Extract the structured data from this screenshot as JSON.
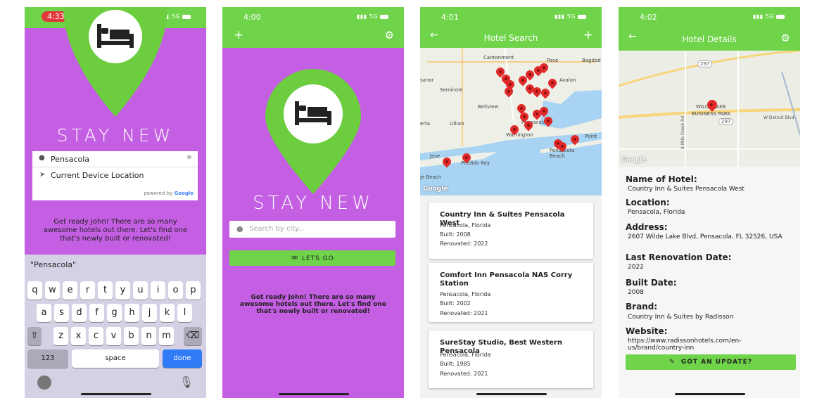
{
  "screen1": {
    "time": "4:33",
    "signal": "5G",
    "app_title": "STAY NEW",
    "search_value": "Pensacola",
    "suggestion": "Current Device Location",
    "powered_by": "powered by",
    "powered_brand": "Google",
    "welcome": "Get ready John! There are so many awesome hotels out there. Let's find one that's newly built or renovated!",
    "autocorrect": "\"Pensacola\"",
    "keys_row1": [
      "q",
      "w",
      "e",
      "r",
      "t",
      "y",
      "u",
      "i",
      "o",
      "p"
    ],
    "keys_row2": [
      "a",
      "s",
      "d",
      "f",
      "g",
      "h",
      "j",
      "k",
      "l"
    ],
    "keys_row3": [
      "z",
      "x",
      "c",
      "v",
      "b",
      "n",
      "m"
    ],
    "key_123": "123",
    "key_space": "space",
    "key_done": "done"
  },
  "screen2": {
    "time": "4:00",
    "signal": "5G",
    "app_title": "STAY NEW",
    "search_placeholder": "Search by city...",
    "lets_go": "LETS GO",
    "welcome": "Get ready John! There are so many awesome hotels out there. Let's find one that's newly built or renovated!"
  },
  "screen3": {
    "time": "4:01",
    "signal": "5G",
    "header_title": "Hotel Search",
    "map_labels": [
      "Cantonment",
      "Pace",
      "Bagdad",
      "Seminole",
      "Avalon",
      "Bellview",
      "Lillian",
      "Warrington",
      "Pensacola",
      "Point",
      "Perdido Key",
      "Pensacola Beach",
      "Jose",
      "erta",
      "je Beach",
      "sanor"
    ],
    "google": "Google",
    "hotels": [
      {
        "name": "Country Inn & Suites Pensacola West",
        "location": "Pensacola, Florida",
        "built": "Built: 2008",
        "renovated": "Renovated: 2022"
      },
      {
        "name": "Comfort Inn Pensacola NAS Corry Station",
        "location": "Pensacola, Florida",
        "built": "Built: 2002",
        "renovated": "Renovated: 2021"
      },
      {
        "name": "SureStay Studio, Best Western Pensacola",
        "location": "Pensacola, Florida",
        "built": "Built: 1985",
        "renovated": "Renovated: 2021"
      }
    ]
  },
  "screen4": {
    "time": "4:02",
    "signal": "5G",
    "header_title": "Hotel Details",
    "map_label1": "WILDE LAKE",
    "map_label2": "BUSINESS PARK",
    "map_road": "W Detroit Blvd",
    "map_road2": "8 Mile Creek Rd",
    "route1": "297",
    "route2": "297",
    "google": "Google",
    "name_label": "Name of Hotel:",
    "name_value": "Country Inn & Suites Pensacola West",
    "location_label": "Location:",
    "location_value": "Pensacola, Florida",
    "address_label": "Address:",
    "address_value": "2607 Wilde Lake Blvd, Pensacola, FL 32526, USA",
    "renovation_label": "Last Renovation Date:",
    "renovation_value": "2022",
    "built_label": "Built Date:",
    "built_value": "2008",
    "brand_label": "Brand:",
    "brand_value": "Country Inn & Suites by Radisson",
    "website_label": "Website:",
    "website_value": "https://www.radissonhotels.com/en-us/brand/country-inn",
    "update_button": "GOT AN UPDATE?"
  },
  "colors": {
    "green": "#6fd44a",
    "purple": "#c45ee3",
    "pin_green": "#6ccd3f",
    "marker_red": "#e02a2a"
  },
  "icons": [
    "bed-icon",
    "location-pin-icon",
    "navigation-arrow-icon",
    "plus-icon",
    "gear-icon",
    "back-arrow-icon",
    "infinity-icon",
    "pencil-icon",
    "shift-icon",
    "delete-icon",
    "emoji-icon",
    "microphone-icon"
  ]
}
